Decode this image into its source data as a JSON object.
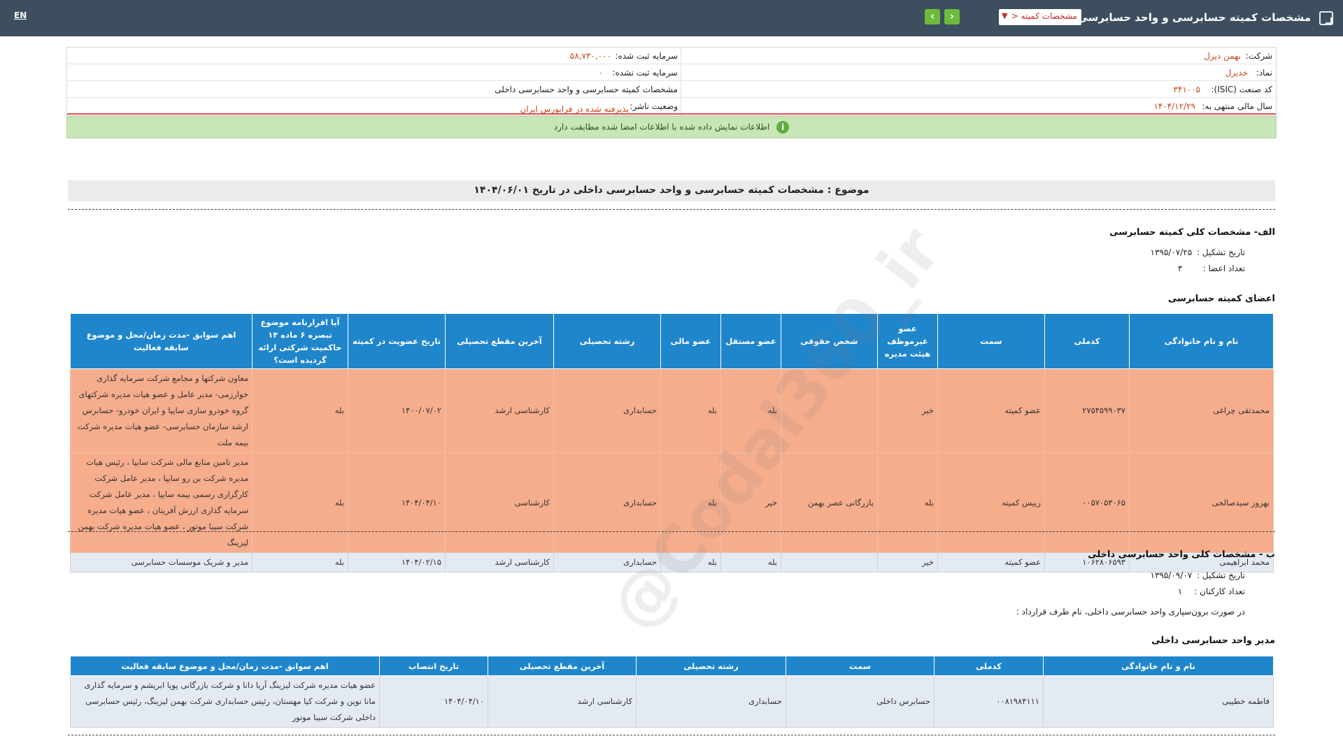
{
  "topbar": {
    "lang_label": "EN",
    "title": "مشخصات کمیته حسابرسی و واحد حسابرسی داخلی",
    "report_select_value": "مشخصات کمیته",
    "prev_label": "‹",
    "next_label": "›"
  },
  "info": {
    "company_label": "شرکت:",
    "company_value": "بهمن دیزل",
    "symbol_label": "نماد:",
    "symbol_value": "خدیزل",
    "isic_label": "کد صنعت (ISIC):",
    "isic_value": "۳۴۱۰۰۵",
    "fiscal_label": "سال مالی منتهی به:",
    "fiscal_value": "۱۴۰۴/۱۲/۲۹",
    "reg_capital_label": "سرمایه ثبت شده:",
    "reg_capital_value": "۵۸,۷۳۰,۰۰۰",
    "unreg_capital_label": "سرمایه ثبت نشده:",
    "unreg_capital_value": "۰",
    "report_type_label": "مشخصات کمیته حسابرسی و واحد حسابرسی داخلی",
    "publisher_status_label": "وضعیت ناشر:",
    "publisher_status_value": "پذیرفته شده در فرابورس ایران"
  },
  "alert": {
    "icon": "info-icon",
    "text": "اطلاعات نمایش داده شده با اطلاعات امضا شده مطابقت دارد"
  },
  "subject": "موضوع : مشخصات کمیته حسابرسی و واحد حسابرسی داخلی در تاریخ ۱۴۰۴/۰۶/۰۱",
  "section_a": {
    "title": "الف- مشخصات کلی کمیته حسابرسی",
    "formation_label": "تاریخ تشکیل :",
    "formation_value": "۱۳۹۵/۰۷/۲۵",
    "members_count_label": "تعداد اعضا :",
    "members_count_value": "۳",
    "members_title": "اعضای کمیته حسابرسی",
    "columns": [
      "نام و نام خانوادگی",
      "کدملی",
      "سمت",
      "عضو غیرموظف هیئت مدیره",
      "شخص حقوقی",
      "عضو مستقل",
      "عضو مالی",
      "رشته تحصیلی",
      "آخرین مقطع تحصیلی",
      "تاریخ عضویت در کمیته",
      "آیا اقرارنامه موضوع تبصره ۶ ماده ۱۴ حاکمیت شرکتی ارائه گردیده است؟",
      "اهم سوابق -مدت زمان/محل و موضوع سابقه فعالیت"
    ],
    "rows": [
      {
        "name": "محمدتقی چراغی",
        "national_id": "۲۷۵۴۵۹۹۰۳۷",
        "position": "عضو کمیته",
        "non_exec_director": "خیر",
        "legal_entity": "",
        "independent": "بله",
        "financial": "بله",
        "field": "حسابداری",
        "degree": "کارشناسی ارشد",
        "join_date": "۱۴۰۰/۰۷/۰۲",
        "declaration": "بله",
        "history": "معاون شرکتها و مجامع شرکت سرمایه گذاری خوارزمی- مدیر عامل و عضو هیات مدیره شرکتهای گروه خودرو سازی سایپا و ایران خودرو- حسابرس ارشد سازمان حسابرسی- عضو هیات مدیره شرکت بیمه ملت"
      },
      {
        "name": "بهروز سیدصالحی",
        "national_id": "۰۰۵۷۰۵۳۰۶۵",
        "position": "رییس کمیته",
        "non_exec_director": "بله",
        "legal_entity": "بازرگانی عصر بهمن",
        "independent": "خیر",
        "financial": "بله",
        "field": "حسابداری",
        "degree": "کارشناسی",
        "join_date": "۱۴۰۴/۰۴/۱۰",
        "declaration": "بله",
        "history": "مدیر تامین منابع مالی شرکت سایپا ، رئیس هیات مدیره شرکت بن رو سایپا ، مدیر عامل شرکت کارگزاری رسمی بیمه سایپا ، مدیر عامل شرکت سرمایه گذاری ارزش آفرینان ، عضو هیات مدیره شرکت سیبا موتور ، عضو هیات مدیره شرکت بهمن لیزینگ"
      },
      {
        "name": "محمد ابراهیمی",
        "national_id": "۱۰۶۲۸۰۶۵۹۳",
        "position": "عضو کمیته",
        "non_exec_director": "خیر",
        "legal_entity": "",
        "independent": "بله",
        "financial": "بله",
        "field": "حسابداری",
        "degree": "کارشناسی ارشد",
        "join_date": "۱۴۰۴/۰۲/۱۵",
        "declaration": "بله",
        "history": "مدیر و شریک موسسات حسابرسی"
      }
    ]
  },
  "section_b": {
    "title": "ب - مشخصات کلی واحد حسابرسی داخلی",
    "formation_label": "تاریخ تشکیل :",
    "formation_value": "۱۳۹۵/۰۹/۰۷",
    "staff_count_label": "تعداد کارکنان :",
    "staff_count_value": "۱",
    "outsourcing_label": "در صورت برون‌سپاری واحد حسابرسی داخلی، نام طرف قرارداد :",
    "manager_title": "مدیر واحد حسابرسی داخلی",
    "columns": [
      "نام و نام خانوادگی",
      "کدملی",
      "سمت",
      "رشته تحصیلی",
      "آخرین مقطع تحصیلی",
      "تاریخ انتصاب",
      "اهم سوابق -مدت زمان/محل و موضوع سابقه فعالیت"
    ],
    "rows": [
      {
        "name": "فاطمه خطیبی",
        "national_id": "۰۰۸۱۹۸۴۱۱۱",
        "position": "حسابرس داخلی",
        "field": "حسابداری",
        "degree": "کارشناسی ارشد",
        "appoint_date": "۱۴۰۴/۰۴/۱۰",
        "history": "عضو هیات مدیره شرکت لیزینگ آریا دانا و شرکت بازرگانی پویا ابریشم و سرمایه گذاری مانا نوین و شرکت کیا مهستان، رئیس حسابداری شرکت بهمن لیزینگ، رئیس حسابرسی داخلی شرکت سیبا موتور"
      }
    ]
  },
  "watermark": "@Codal360_ir"
}
